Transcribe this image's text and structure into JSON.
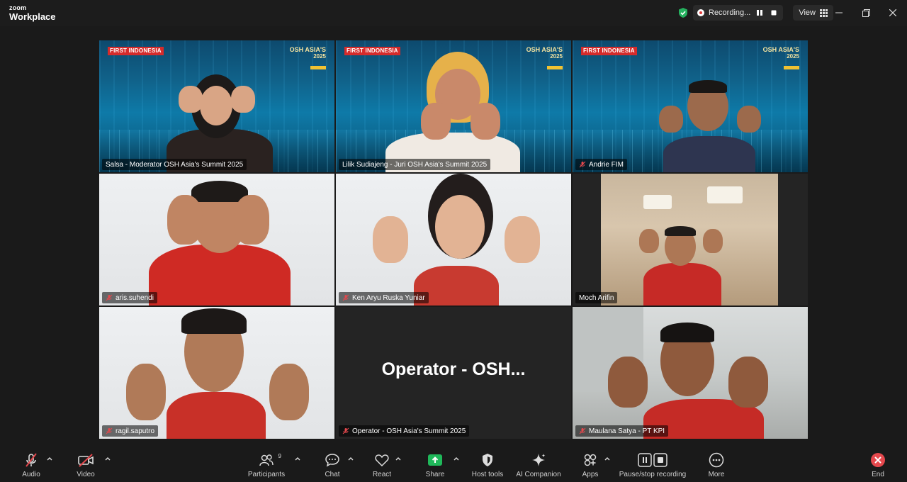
{
  "app": {
    "logo_top": "zoom",
    "logo_bottom": "Workplace"
  },
  "header": {
    "recording_label": "Recording...",
    "view_label": "View"
  },
  "participants": [
    {
      "name": "Salsa - Moderator OSH Asia's Summit 2025",
      "mic_muted": false,
      "active_speaker": true,
      "background": "branded"
    },
    {
      "name": "Lilik Sudiajeng - Juri OSH Asia's Summit 2025",
      "mic_muted": false,
      "active_speaker": false,
      "background": "branded"
    },
    {
      "name": "Andrie FIM",
      "mic_muted": true,
      "active_speaker": false,
      "background": "branded"
    },
    {
      "name": "aris.suhendi",
      "mic_muted": true,
      "active_speaker": false,
      "background": "white"
    },
    {
      "name": "Ken Aryu Ruska Yuniar",
      "mic_muted": true,
      "active_speaker": false,
      "background": "white"
    },
    {
      "name": "Moch Arifin",
      "mic_muted": false,
      "active_speaker": false,
      "background": "room"
    },
    {
      "name": "ragil.saputro",
      "mic_muted": true,
      "active_speaker": false,
      "background": "white"
    },
    {
      "name": "Operator - OSH Asia's Summit 2025",
      "mic_muted": true,
      "active_speaker": false,
      "background": "video-off",
      "display_name": "Operator - OSH..."
    },
    {
      "name": "Maulana Satya - PT KPI",
      "mic_muted": true,
      "active_speaker": false,
      "background": "office"
    }
  ],
  "branding": {
    "first": "FIRST INDONESIA",
    "osh_line1": "OSH ASIA'S",
    "osh_line2": "2025"
  },
  "toolbar": {
    "audio": "Audio",
    "video": "Video",
    "participants": "Participants",
    "participants_count": "9",
    "chat": "Chat",
    "react": "React",
    "share": "Share",
    "host_tools": "Host tools",
    "ai_companion": "AI Companion",
    "apps": "Apps",
    "pause_stop": "Pause/stop recording",
    "more": "More",
    "end": "End"
  },
  "colors": {
    "active_speaker": "#3ad47b",
    "share": "#1fb85a",
    "end": "#e5484d",
    "recording": "#e03a3a",
    "shield": "#25b15f"
  }
}
